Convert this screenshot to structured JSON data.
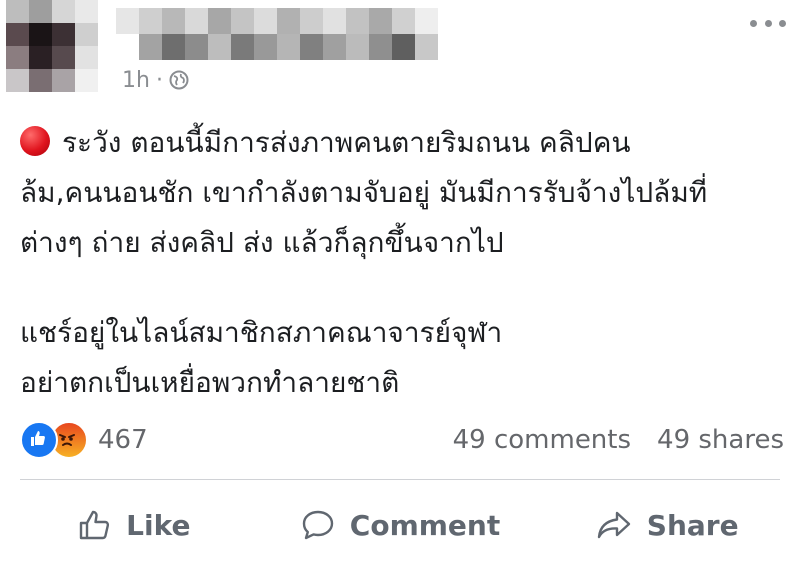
{
  "post": {
    "time": "1h",
    "separator": "·",
    "text_lines": [
      "ระวัง ตอนนี้มีการส่งภาพคนตายริมถนน คลิปคน",
      "ล้ม,คนนอนชัก เขากำลังตามจับอยู่ มันมีการรับจ้างไปล้มที่",
      "ต่างๆ ถ่าย ส่งคลิป ส่ง แล้วก็ลุกขึ้นจากไป",
      "แชร์อยู่ในไลน์สมาชิกสภาคณาจารย์จุฬา",
      "อย่าตกเป็นเหยื่อพวกทำลายชาติ"
    ]
  },
  "stats": {
    "reaction_count": "467",
    "comments": "49 comments",
    "shares": "49 shares"
  },
  "actions": {
    "like": "Like",
    "comment": "Comment",
    "share": "Share"
  },
  "icons": {
    "privacy": "globe-icon",
    "menu": "more-horizontal-icon",
    "reaction_1": "like-reaction-icon",
    "reaction_2": "angry-reaction-icon",
    "like": "thumbs-up-icon",
    "comment": "speech-bubble-icon",
    "share": "share-arrow-icon"
  },
  "colors": {
    "like_blue": "#1877f2",
    "meta_gray": "#8a8d91",
    "action_gray": "#606770"
  }
}
